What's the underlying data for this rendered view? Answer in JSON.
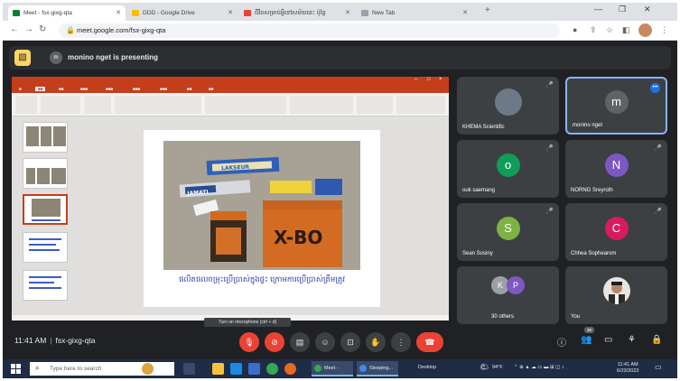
{
  "browser": {
    "tabs": [
      {
        "title": "Meet - fsx-gixg-qta",
        "active": true
      },
      {
        "title": "DDD - Google Drive"
      },
      {
        "title": "ជីវិតសម្រាប់អ្វីនៅសម័យនេះ ប៉ុន្តែ"
      },
      {
        "title": "New Tab"
      }
    ],
    "url": "meet.google.com/fsx-gixg-qta"
  },
  "meet": {
    "presenter_initial": "m",
    "presenting_text": "monino nget is presenting",
    "tooltip": "Turn on microphone (ctrl + d)",
    "time": "11:41 AM",
    "meeting_code": "fsx-gixg-qta",
    "participant_count_badge": "36",
    "participants": [
      {
        "name": "KHEMA Scientific",
        "color": "#6b7a86",
        "initial": ""
      },
      {
        "name": "monino nget",
        "color": "#5f6368",
        "initial": "m"
      },
      {
        "name": "ouk saemang",
        "color": "#0f9d58",
        "initial": "o"
      },
      {
        "name": "NORNG Sreyroth",
        "color": "#7e57c2",
        "initial": "N"
      },
      {
        "name": "Sean Sosiny",
        "color": "#7cb342",
        "initial": "S"
      },
      {
        "name": "Chhea Sophearom",
        "color": "#d81b60",
        "initial": "C"
      },
      {
        "name": "30 others",
        "color": "",
        "initial": ""
      },
      {
        "name": "You",
        "color": "",
        "initial": ""
      }
    ],
    "others_initials": [
      "K",
      "P"
    ]
  },
  "slide": {
    "caption": "ផលិតផលចម្រុះប្រើប្រាស់ក្នុងផ្ទះ ក្រោមការប្រើប្រាស់ត្រឹមត្រូវ",
    "product_labels": [
      "JAMATI",
      "LAKSEUR",
      "X-BO"
    ]
  },
  "taskbar": {
    "search_placeholder": "Type here to search",
    "windows": [
      {
        "label": "Meet -",
        "color": "#34a853"
      },
      {
        "label": "Sleeping...",
        "color": "#4285f4"
      }
    ],
    "desktop_label": "Desktop",
    "weather": "94°F",
    "time": "11:41 AM",
    "date": "6/23/2023"
  },
  "colors": {
    "meet_bg": "#202124",
    "tile_bg": "#3c4043",
    "accent": "#8ab4f8",
    "end_call": "#ea4335",
    "powerpoint": "#c43e1c"
  }
}
